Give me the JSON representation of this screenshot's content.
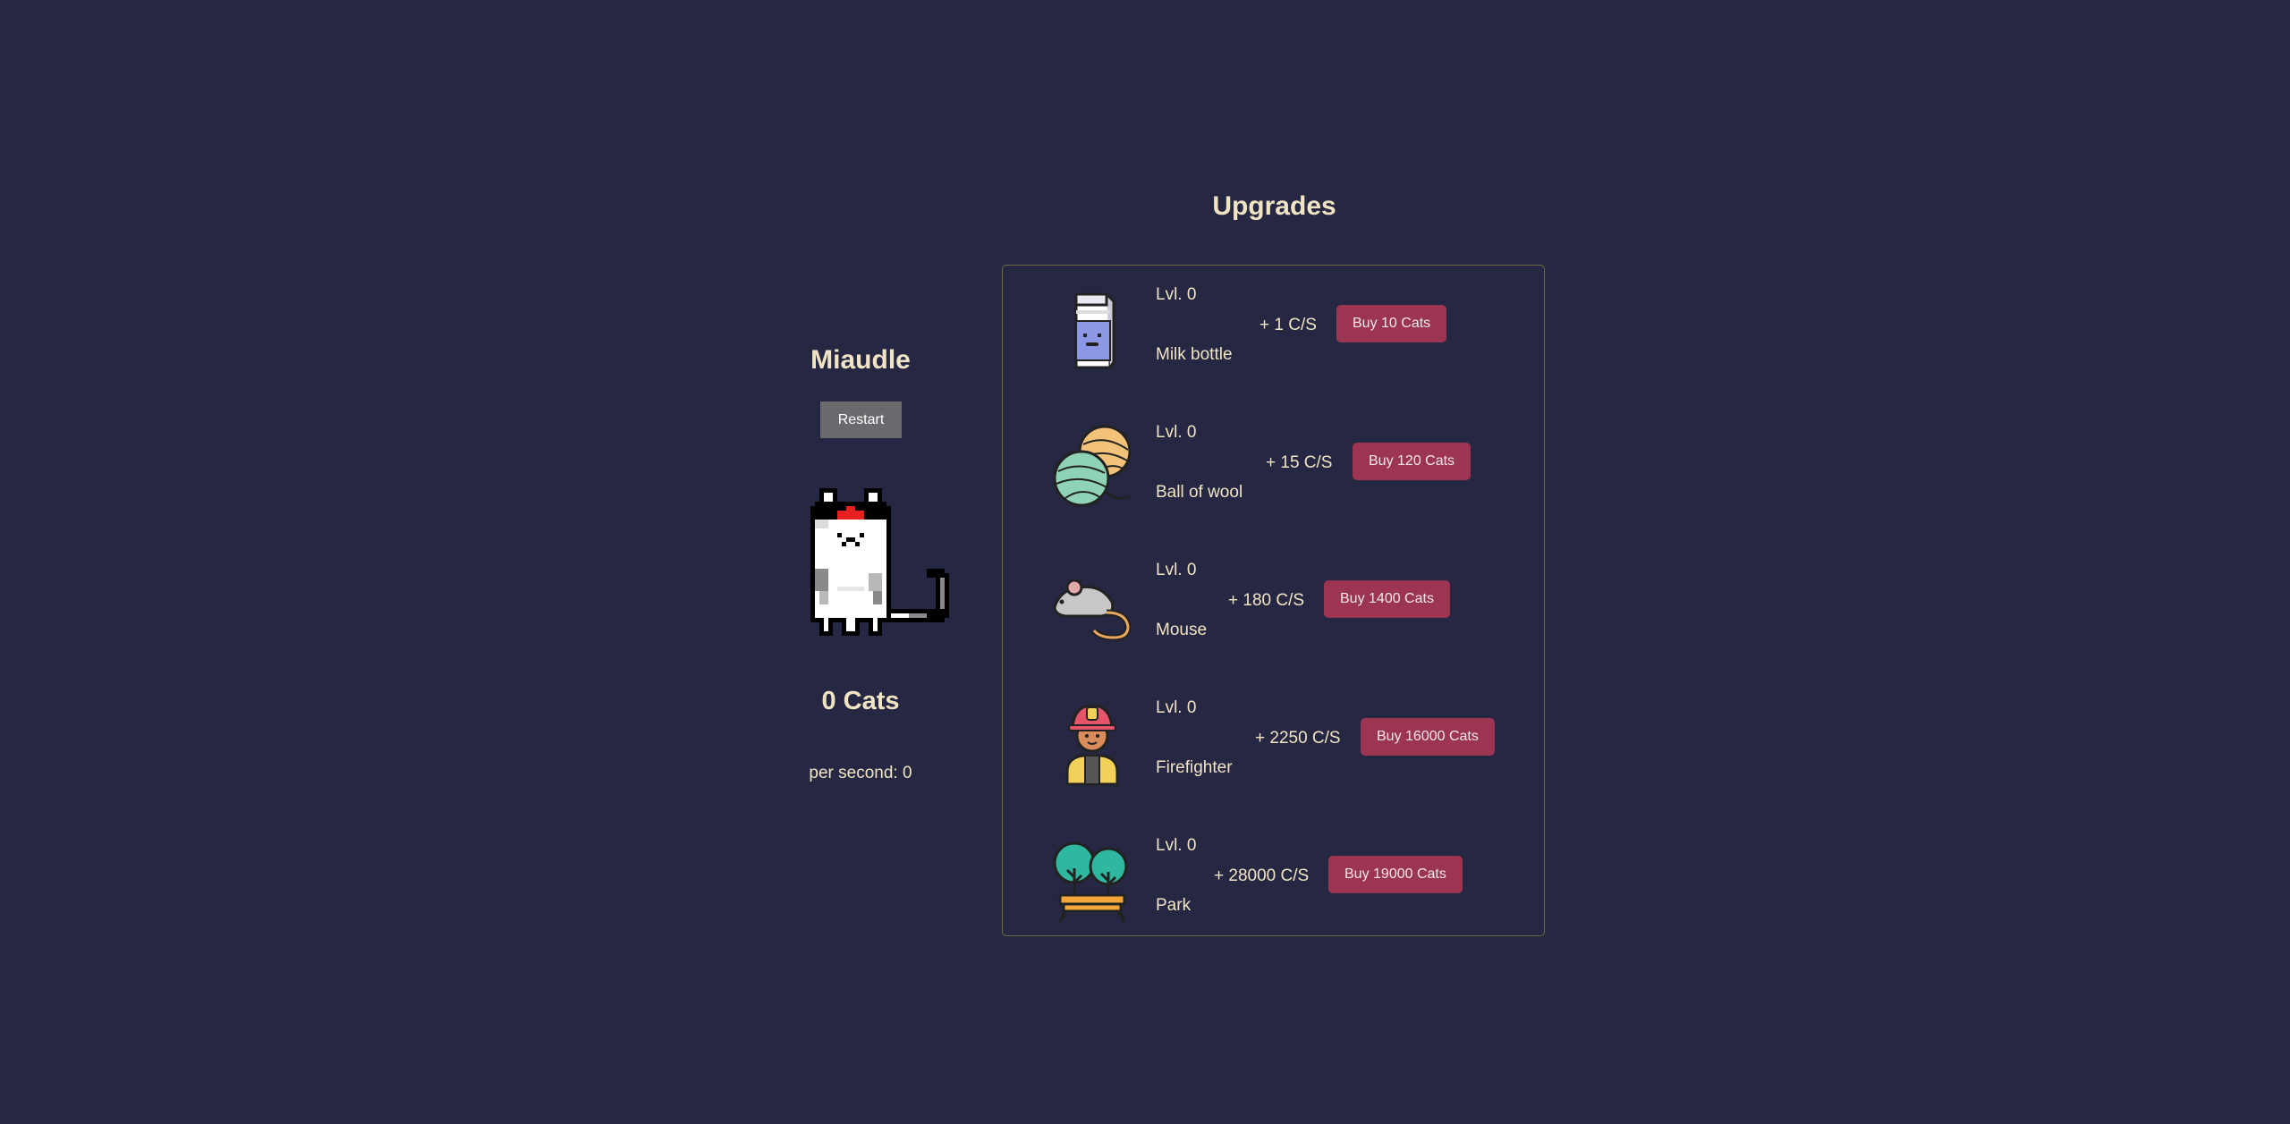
{
  "game": {
    "title": "Miaudle",
    "restart_label": "Restart",
    "cat_count": "0 Cats",
    "per_second": "per second: 0",
    "cat_sprite_icon": "pixel-cat-with-nurse-hat-icon"
  },
  "upgrades": {
    "title": "Upgrades",
    "items": [
      {
        "level": "Lvl. 0",
        "name": "Milk bottle",
        "rate": "+ 1 C/S",
        "buy_label": "Buy 10 Cats",
        "icon": "milk-bottle-icon"
      },
      {
        "level": "Lvl. 0",
        "name": "Ball of wool",
        "rate": "+ 15 C/S",
        "buy_label": "Buy 120 Cats",
        "icon": "ball-of-wool-icon"
      },
      {
        "level": "Lvl. 0",
        "name": "Mouse",
        "rate": "+ 180 C/S",
        "buy_label": "Buy 1400 Cats",
        "icon": "mouse-icon"
      },
      {
        "level": "Lvl. 0",
        "name": "Firefighter",
        "rate": "+ 2250 C/S",
        "buy_label": "Buy 16000 Cats",
        "icon": "firefighter-icon"
      },
      {
        "level": "Lvl. 0",
        "name": "Park",
        "rate": "+ 28000 C/S",
        "buy_label": "Buy 19000 Cats",
        "icon": "park-icon"
      }
    ]
  },
  "colors": {
    "background": "#262843",
    "text": "#f1e4c4",
    "buy_button": "#9b3551",
    "restart_button": "#6a6a6e",
    "box_border": "#6e6a3f"
  }
}
